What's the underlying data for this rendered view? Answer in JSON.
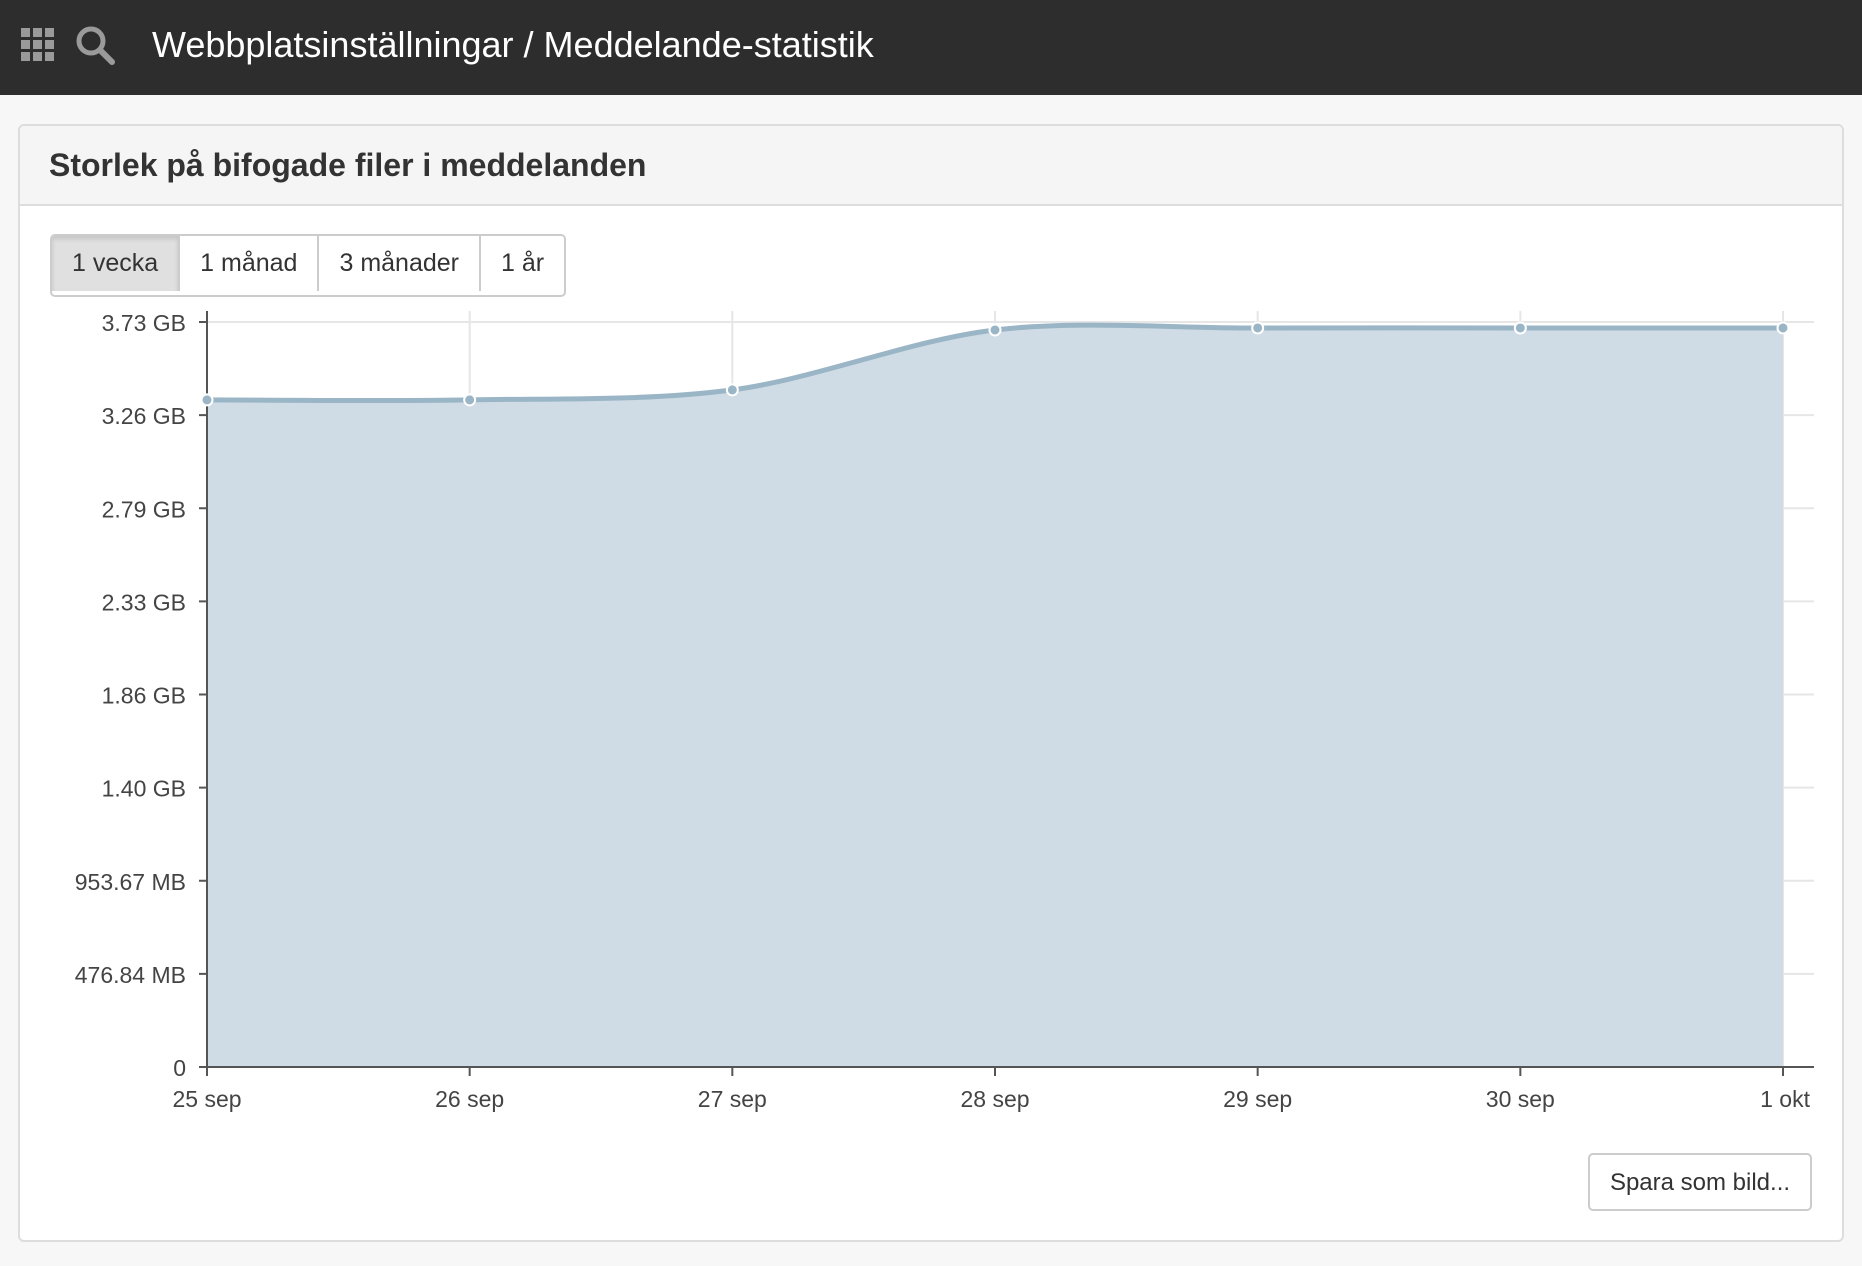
{
  "header": {
    "breadcrumb": "Webbplatsinställningar / Meddelande-statistik",
    "apps_icon": "grid-icon",
    "search_icon": "search-icon"
  },
  "panel": {
    "title": "Storlek på bifogade filer i meddelanden"
  },
  "range_buttons": [
    {
      "label": "1 vecka",
      "active": true
    },
    {
      "label": "1 månad",
      "active": false
    },
    {
      "label": "3 månader",
      "active": false
    },
    {
      "label": "1 år",
      "active": false
    }
  ],
  "save_button": "Spara som bild...",
  "colors": {
    "topbar": "#2d2d2d",
    "area_fill": "#cfdce5",
    "line": "#9ab6c6",
    "grid": "#e6e6e6",
    "axis": "#555555"
  },
  "chart_data": {
    "type": "area",
    "title": "",
    "xlabel": "",
    "ylabel": "",
    "x": [
      "25 sep",
      "26 sep",
      "27 sep",
      "28 sep",
      "29 sep",
      "30 sep",
      "1 okt"
    ],
    "y_ticks": [
      "0",
      "476.84 MB",
      "953.67 MB",
      "1.40 GB",
      "1.86 GB",
      "2.33 GB",
      "2.79 GB",
      "3.26 GB",
      "3.73 GB"
    ],
    "ylim_gb": [
      0,
      3.73
    ],
    "series": [
      {
        "values_gb": [
          3.34,
          3.34,
          3.39,
          3.69,
          3.7,
          3.7,
          3.7
        ]
      }
    ],
    "grid": true,
    "legend": "none"
  }
}
